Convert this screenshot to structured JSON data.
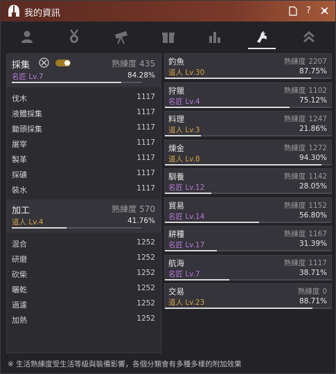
{
  "window": {
    "title": "我的資訊"
  },
  "colors": {
    "master": "#b67ad8",
    "artisan": "#d7a24a",
    "accent_toggle": "#a07a22"
  },
  "tabs": [
    {
      "icon": "person-icon",
      "active": false
    },
    {
      "icon": "medal-icon",
      "active": false
    },
    {
      "icon": "telescope-icon",
      "active": false
    },
    {
      "icon": "gift-icon",
      "active": false
    },
    {
      "icon": "bar-chart-icon",
      "active": false
    },
    {
      "icon": "life-skill-icon",
      "active": true
    },
    {
      "icon": "double-chevron-up-icon",
      "active": false
    }
  ],
  "groups": [
    {
      "name": "採集",
      "prof_label": "熟練度",
      "prof_value": "435",
      "rank": "名匠 Lv.7",
      "rank_class": "master",
      "percent": "84.28%",
      "progress": 0.8428,
      "toggle_on": true,
      "items": [
        {
          "name": "伐木",
          "value": "1117"
        },
        {
          "name": "液體採集",
          "value": "1117"
        },
        {
          "name": "鋤頭採集",
          "value": "1117"
        },
        {
          "name": "屠宰",
          "value": "1117"
        },
        {
          "name": "製革",
          "value": "1117"
        },
        {
          "name": "採礦",
          "value": "1117"
        },
        {
          "name": "裝水",
          "value": "1117"
        }
      ]
    },
    {
      "name": "加工",
      "prof_label": "熟練度",
      "prof_value": "570",
      "rank": "道人 Lv.4",
      "rank_class": "artisan",
      "percent": "41.76%",
      "progress": 0.4176,
      "items": [
        {
          "name": "混合",
          "value": "1252"
        },
        {
          "name": "研磨",
          "value": "1252"
        },
        {
          "name": "砍柴",
          "value": "1252"
        },
        {
          "name": "曬乾",
          "value": "1252"
        },
        {
          "name": "過濾",
          "value": "1252"
        },
        {
          "name": "加熱",
          "value": "1252"
        }
      ]
    }
  ],
  "skills": [
    {
      "name": "釣魚",
      "prof_label": "熟練度",
      "prof_value": "2207",
      "rank": "道人 Lv.30",
      "rank_class": "artisan",
      "percent": "87.75%",
      "progress": 0.8775
    },
    {
      "name": "狩獵",
      "prof_label": "熟練度",
      "prof_value": "1102",
      "rank": "名匠 Lv.4",
      "rank_class": "master",
      "percent": "75.12%",
      "progress": 0.7512
    },
    {
      "name": "料理",
      "prof_label": "熟練度",
      "prof_value": "1247",
      "rank": "道人 Lv.3",
      "rank_class": "artisan",
      "percent": "21.86%",
      "progress": 0.2186
    },
    {
      "name": "煉金",
      "prof_label": "熟練度",
      "prof_value": "1272",
      "rank": "道人 Lv.8",
      "rank_class": "artisan",
      "percent": "94.30%",
      "progress": 0.943
    },
    {
      "name": "馴養",
      "prof_label": "熟練度",
      "prof_value": "1142",
      "rank": "名匠 Lv.12",
      "rank_class": "master",
      "percent": "28.05%",
      "progress": 0.2805
    },
    {
      "name": "貿易",
      "prof_label": "熟練度",
      "prof_value": "1152",
      "rank": "名匠 Lv.14",
      "rank_class": "master",
      "percent": "56.80%",
      "progress": 0.568
    },
    {
      "name": "耕種",
      "prof_label": "熟練度",
      "prof_value": "1167",
      "rank": "名匠 Lv.17",
      "rank_class": "master",
      "percent": "31.39%",
      "progress": 0.3139
    },
    {
      "name": "航海",
      "prof_label": "熟練度",
      "prof_value": "1117",
      "rank": "名匠 Lv.7",
      "rank_class": "master",
      "percent": "38.71%",
      "progress": 0.3871
    },
    {
      "name": "交易",
      "prof_label": "熟練度",
      "prof_value": "0",
      "rank": "道人 Lv.23",
      "rank_class": "artisan",
      "percent": "88.71%",
      "progress": 0.8871
    }
  ],
  "footer": "※ 生活熟練度受生活等級與裝備影響，各個分類會有多種多樣的附加效果"
}
